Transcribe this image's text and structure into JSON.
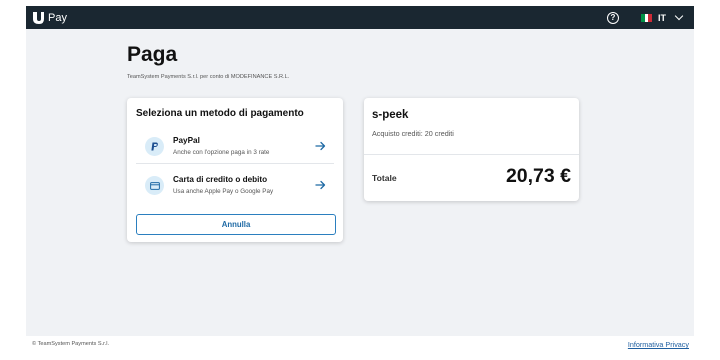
{
  "header": {
    "app_name": "Pay",
    "language": "IT",
    "flag_colors": [
      "#009246",
      "#ffffff",
      "#ce2b37"
    ]
  },
  "page": {
    "title": "Paga",
    "subtitle": "TeamSystem Payments S.r.l. per conto di MODEFINANCE S.R.L."
  },
  "payment_methods": {
    "heading": "Seleziona un metodo di pagamento",
    "items": [
      {
        "name": "PayPal",
        "description": "Anche con l'opzione paga in 3 rate",
        "icon": "paypal-icon"
      },
      {
        "name": "Carta di credito o debito",
        "description": "Usa anche Apple Pay o Google Pay",
        "icon": "credit-card-icon"
      }
    ],
    "cancel_label": "Annulla"
  },
  "summary": {
    "merchant": "s-peek",
    "purchase": "Acquisto crediti: 20 crediti",
    "total_label": "Totale",
    "total_amount": "20,73 €"
  },
  "footer": {
    "copyright": "© TeamSystem Payments S.r.l.",
    "privacy_link": "Informativa Privacy"
  },
  "colors": {
    "topbar": "#1a2731",
    "accent": "#2b7fbf",
    "background": "#f0f2f5"
  }
}
